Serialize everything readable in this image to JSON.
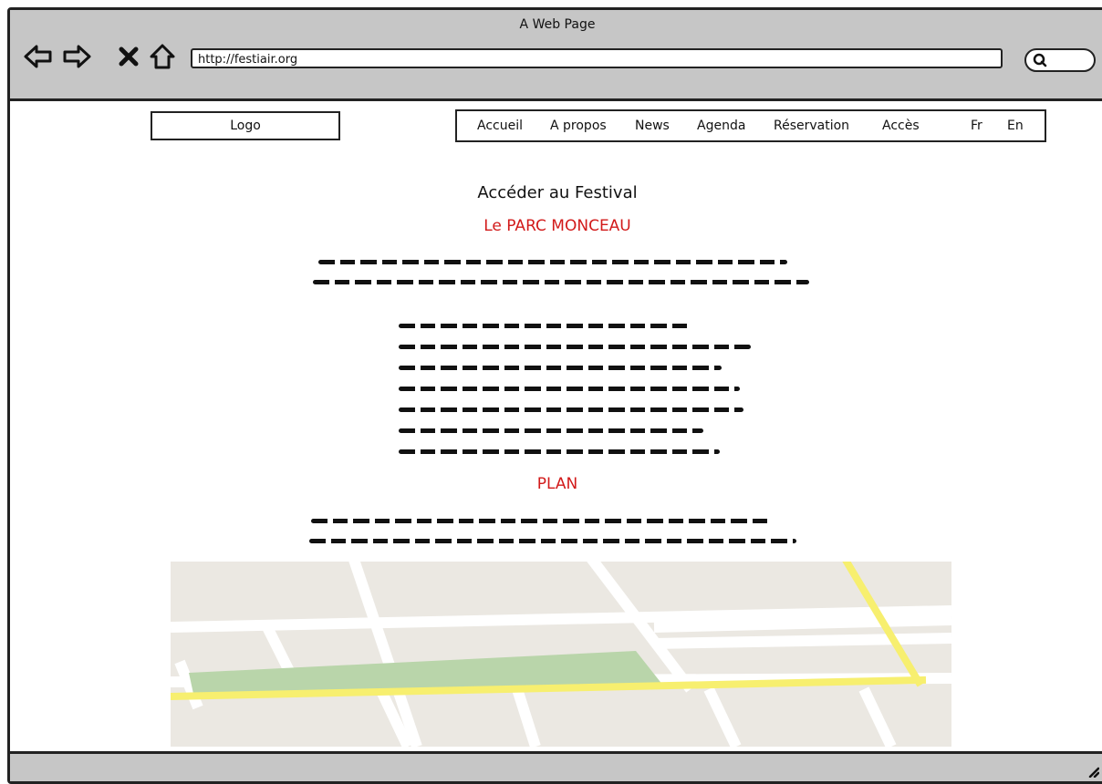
{
  "browser": {
    "window_title": "A Web Page",
    "url": "http://festiair.org"
  },
  "header": {
    "logo_label": "Logo",
    "nav": [
      "Accueil",
      "A propos",
      "News",
      "Agenda",
      "Réservation",
      "Accès",
      "Fr",
      "En"
    ]
  },
  "main": {
    "title": "Accéder au Festival",
    "section1_title": "Le PARC MONCEAU",
    "section2_title": "PLAN"
  },
  "colors": {
    "accent_red": "#d21a1a",
    "map_park": "#b9d5aa",
    "map_main_road": "#f7ef6f"
  }
}
